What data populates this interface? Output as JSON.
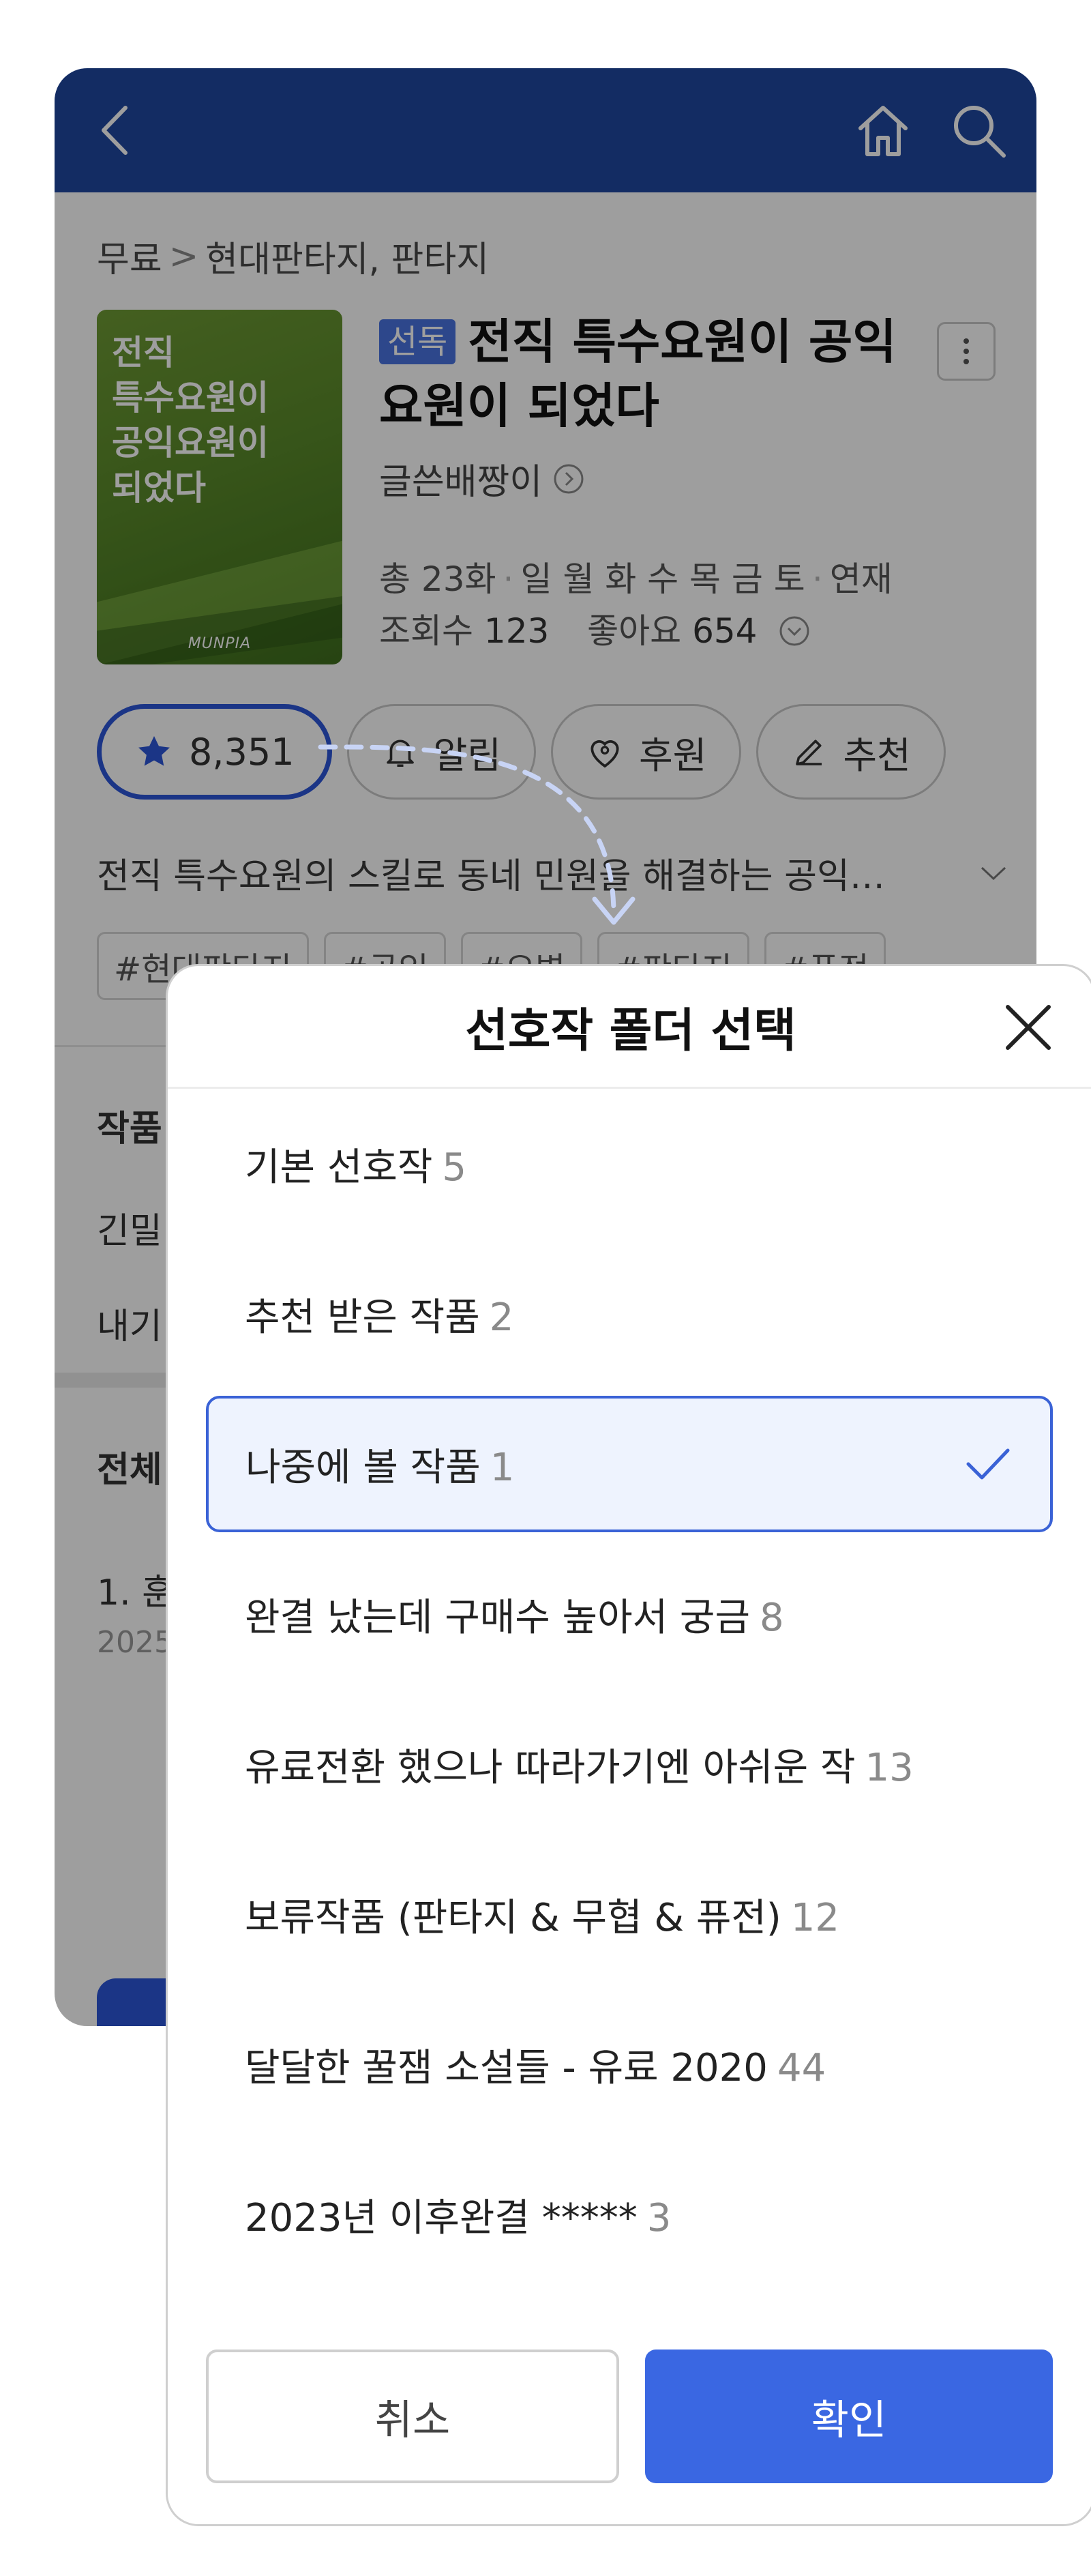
{
  "header": {
    "back_icon": "back-arrow-icon",
    "home_icon": "home-icon",
    "search_icon": "search-icon"
  },
  "breadcrumb": {
    "root": "무료",
    "separator": ">",
    "genre": "현대판타지, 판타지"
  },
  "cover": {
    "title_lines": [
      "전직",
      "특수요원이",
      "공익요원이",
      "되었다"
    ],
    "brand": "MUNPIA"
  },
  "novel": {
    "badge": "선독",
    "title": "전직 특수요원이 공익요원이 되었다",
    "author": "글쓴배짱이",
    "episodes": "총 23화",
    "schedule": "일 월 화 수 목 금 토",
    "status": "연재",
    "views_label": "조회수",
    "views": "123",
    "likes_label": "좋아요",
    "likes": "654"
  },
  "actions": {
    "favorite_count": "8,351",
    "alarm": "알림",
    "support": "후원",
    "recommend": "추천"
  },
  "description": "전직 특수요원의 스킬로 동네 민원을 해결하는 공익…",
  "tags": [
    "#현대판타지",
    "#공익",
    "#요병",
    "#판타지",
    "#퓨전"
  ],
  "sections": {
    "work_info": "작품",
    "row_a": "긴밀",
    "row_b": "내기",
    "all_episodes": "전체",
    "episode_1": "1. 훈",
    "episode_1_date": "2025"
  },
  "modal": {
    "title": "선호작 폴더 선택",
    "folders": [
      {
        "name": "기본 선호작",
        "count": "5"
      },
      {
        "name": "추천 받은 작품",
        "count": "2"
      },
      {
        "name": "나중에 볼 작품",
        "count": "1",
        "selected": true
      },
      {
        "name": "완결 났는데 구매수 높아서 궁금",
        "count": "8"
      },
      {
        "name": "유료전환 했으나 따라가기엔 아쉬운 작",
        "count": "13"
      },
      {
        "name": "보류작품 (판타지 & 무협 & 퓨전)",
        "count": "12"
      },
      {
        "name": "달달한 꿀잼 소설들 - 유료 2020",
        "count": "44"
      },
      {
        "name": "2023년 이후완결 *****",
        "count": "3"
      }
    ],
    "cancel": "취소",
    "confirm": "확인"
  },
  "colors": {
    "header_bg": "#1f47a0",
    "accent": "#3a67e2",
    "selected_bg": "#eef3fe"
  }
}
